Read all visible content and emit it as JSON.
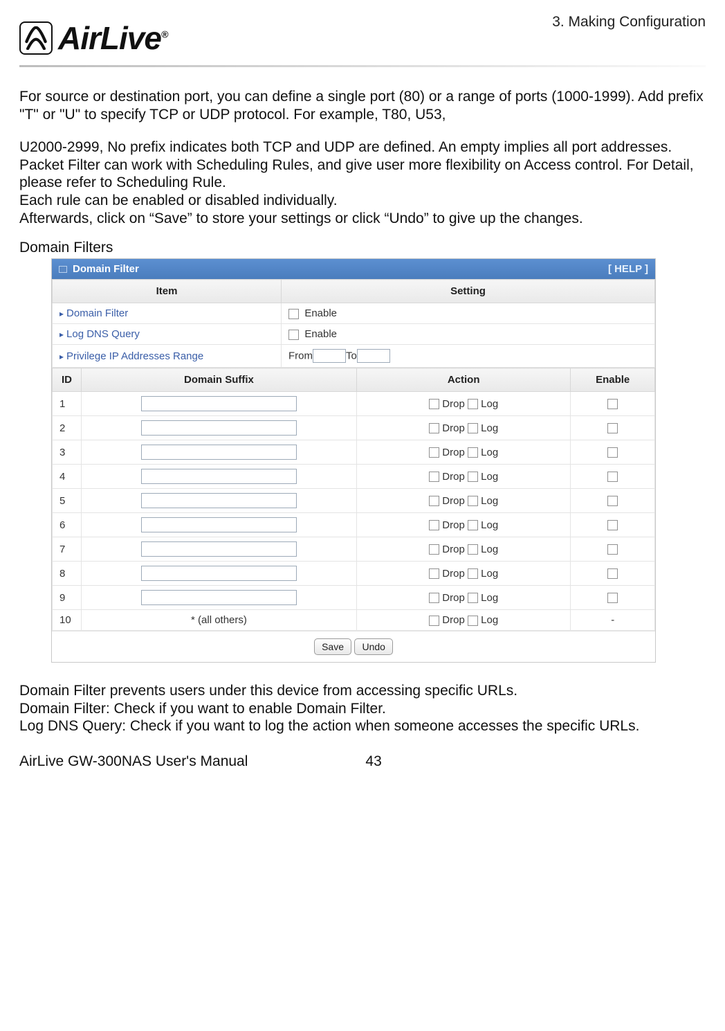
{
  "header": {
    "chapter": "3.  Making  Configuration",
    "brand_part1": "Air",
    "brand_part2": "Live",
    "trademark": "®"
  },
  "intro": {
    "p1": "For source or destination port, you can define a single port (80) or a range of ports (1000-1999). Add prefix \"T\" or \"U\" to specify TCP or UDP protocol. For example, T80, U53,",
    "p2": "U2000-2999, No prefix indicates both TCP and UDP are defined. An empty implies all port addresses. Packet Filter can work with Scheduling Rules, and give user more flexibility on Access control. For Detail, please refer to Scheduling Rule.",
    "p3": "Each rule can be enabled or disabled individually.",
    "p4": "Afterwards, click on “Save” to store your settings or click “Undo” to give up the changes."
  },
  "section_label": "Domain Filters",
  "panel": {
    "title": "Domain Filter",
    "help": "[ HELP ]",
    "headers": {
      "item": "Item",
      "setting": "Setting"
    },
    "items": {
      "domain_filter": {
        "label": "Domain Filter",
        "option": "Enable"
      },
      "log_dns": {
        "label": "Log DNS Query",
        "option": "Enable"
      },
      "privilege": {
        "label": "Privilege IP Addresses Range",
        "from": "From",
        "to": "To"
      }
    },
    "table_headers": {
      "id": "ID",
      "suffix": "Domain Suffix",
      "action": "Action",
      "enable": "Enable"
    },
    "action_labels": {
      "drop": "Drop",
      "log": "Log"
    },
    "rows": [
      {
        "id": "1"
      },
      {
        "id": "2"
      },
      {
        "id": "3"
      },
      {
        "id": "4"
      },
      {
        "id": "5"
      },
      {
        "id": "6"
      },
      {
        "id": "7"
      },
      {
        "id": "8"
      },
      {
        "id": "9"
      }
    ],
    "last_row": {
      "id": "10",
      "suffix_label": "* (all others)",
      "enable_mark": "-"
    },
    "buttons": {
      "save": "Save",
      "undo": "Undo"
    }
  },
  "outro": {
    "p1": "Domain Filter prevents users under this device from accessing specific URLs.",
    "p2": "Domain Filter: Check if you want to enable Domain Filter.",
    "p3": "Log DNS Query: Check if you want to log the action when someone accesses the specific URLs."
  },
  "footer": {
    "manual": "AirLive GW-300NAS User's Manual",
    "page": "43"
  }
}
